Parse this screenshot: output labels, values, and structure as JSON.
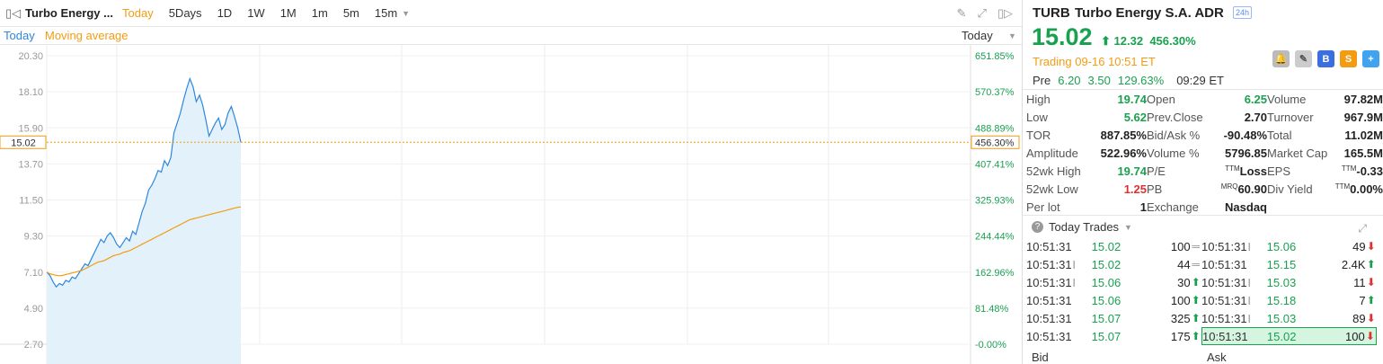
{
  "toolbar": {
    "name": "Turbo Energy ...",
    "ranges": [
      "Today",
      "5Days",
      "1D",
      "1W",
      "1M",
      "1m",
      "5m",
      "15m"
    ],
    "active": "Today"
  },
  "subbar": {
    "today": "Today",
    "ma": "Moving average",
    "select": "Today"
  },
  "chart_data": {
    "type": "line",
    "ylim": [
      2.7,
      20.3
    ],
    "yticks_left": [
      "20.30",
      "18.10",
      "15.90",
      "13.70",
      "11.50",
      "9.30",
      "7.10",
      "4.90",
      "2.70"
    ],
    "yticks_right": [
      "651.85%",
      "570.37%",
      "488.89%",
      "407.41%",
      "325.93%",
      "244.44%",
      "162.96%",
      "81.48%",
      "-0.00%"
    ],
    "current_price": "15.02",
    "current_pct": "456.30%",
    "series": [
      {
        "values": [
          7.1,
          6.9,
          6.5,
          6.2,
          6.4,
          6.3,
          6.6,
          6.5,
          6.8,
          6.7,
          7.0,
          7.3,
          7.6,
          7.5,
          7.9,
          8.3,
          8.7,
          9.1,
          8.9,
          9.3,
          9.5,
          9.2,
          8.8,
          8.6,
          8.9,
          9.2,
          9.0,
          9.6,
          9.4,
          10.1,
          10.8,
          11.3,
          12.1,
          12.4,
          12.8,
          13.3,
          13.2,
          13.9,
          13.6,
          14.1,
          15.6,
          16.2,
          16.8,
          17.6,
          18.3,
          18.9,
          18.4,
          17.5,
          17.9,
          17.3,
          16.4,
          15.4,
          15.8,
          16.2,
          16.5,
          15.8,
          16.1,
          16.8,
          17.2,
          16.6,
          15.9,
          15.02
        ]
      },
      {
        "values": [
          7.1,
          7.0,
          6.95,
          6.9,
          6.88,
          6.9,
          6.95,
          7.0,
          7.05,
          7.1,
          7.15,
          7.2,
          7.3,
          7.4,
          7.5,
          7.6,
          7.7,
          7.75,
          7.8,
          7.9,
          8.0,
          8.1,
          8.15,
          8.2,
          8.3,
          8.35,
          8.4,
          8.5,
          8.6,
          8.7,
          8.8,
          8.9,
          9.0,
          9.1,
          9.2,
          9.3,
          9.4,
          9.5,
          9.6,
          9.7,
          9.8,
          9.9,
          10.0,
          10.1,
          10.2,
          10.3,
          10.35,
          10.4,
          10.45,
          10.5,
          10.55,
          10.6,
          10.65,
          10.7,
          10.75,
          10.8,
          10.85,
          10.9,
          10.95,
          11.0,
          11.05,
          11.08
        ]
      }
    ]
  },
  "quote": {
    "ticker": "TURB",
    "name": "Turbo Energy S.A. ADR",
    "badge": "24h",
    "price": "15.02",
    "change": "12.32",
    "pct": "456.30%",
    "status": "Trading 09-16 10:51 ET",
    "buttons": [
      "B",
      "S",
      "+"
    ]
  },
  "pre": {
    "label": "Pre",
    "price": "6.20",
    "chg": "3.50",
    "pct": "129.63%",
    "time": "09:29 ET"
  },
  "stats": [
    [
      [
        "High",
        "19.74",
        "g"
      ],
      [
        "Open",
        "6.25",
        "g"
      ],
      [
        "Volume",
        "97.82M",
        ""
      ]
    ],
    [
      [
        "Low",
        "5.62",
        "g"
      ],
      [
        "Prev.Close",
        "2.70",
        ""
      ],
      [
        "Turnover",
        "967.9M",
        ""
      ]
    ],
    [
      [
        "TOR",
        "887.85%",
        ""
      ],
      [
        "Bid/Ask %",
        "-90.48%",
        ""
      ],
      [
        "Total",
        "11.02M",
        ""
      ]
    ],
    [
      [
        "Amplitude",
        "522.96%",
        ""
      ],
      [
        "Volume %",
        "5796.85",
        ""
      ],
      [
        "Market Cap",
        "165.5M",
        ""
      ]
    ],
    [
      [
        "52wk High",
        "19.74",
        "g"
      ],
      [
        "P/E",
        "Loss",
        ""
      ],
      [
        "EPS",
        "-0.33",
        ""
      ]
    ],
    [
      [
        "52wk Low",
        "1.25",
        "r"
      ],
      [
        "PB",
        "60.90",
        ""
      ],
      [
        "Div Yield",
        "0.00%",
        ""
      ]
    ],
    [
      [
        "Per lot",
        "1",
        ""
      ],
      [
        "Exchange",
        "Nasdaq",
        ""
      ],
      [
        "",
        "",
        " "
      ]
    ]
  ],
  "trades_title": "Today Trades",
  "trades": [
    [
      [
        "10:51:31",
        "",
        "15.02",
        "100",
        "eq"
      ],
      [
        "10:51:31",
        "I",
        "15.06",
        "49",
        "dn"
      ]
    ],
    [
      [
        "10:51:31",
        "I",
        "15.02",
        "44",
        "eq"
      ],
      [
        "10:51:31",
        "",
        "15.15",
        "2.4K",
        "up"
      ]
    ],
    [
      [
        "10:51:31",
        "I",
        "15.06",
        "30",
        "up"
      ],
      [
        "10:51:31",
        "I",
        "15.03",
        "11",
        "dn"
      ]
    ],
    [
      [
        "10:51:31",
        "",
        "15.06",
        "100",
        "up"
      ],
      [
        "10:51:31",
        "I",
        "15.18",
        "7",
        "up"
      ]
    ],
    [
      [
        "10:51:31",
        "",
        "15.07",
        "325",
        "up"
      ],
      [
        "10:51:31",
        "I",
        "15.03",
        "89",
        "dn"
      ]
    ],
    [
      [
        "10:51:31",
        "",
        "15.07",
        "175",
        "up"
      ],
      [
        "10:51:31",
        "",
        "15.02",
        "100",
        "dn"
      ]
    ]
  ],
  "bid": "Bid",
  "ask": "Ask"
}
